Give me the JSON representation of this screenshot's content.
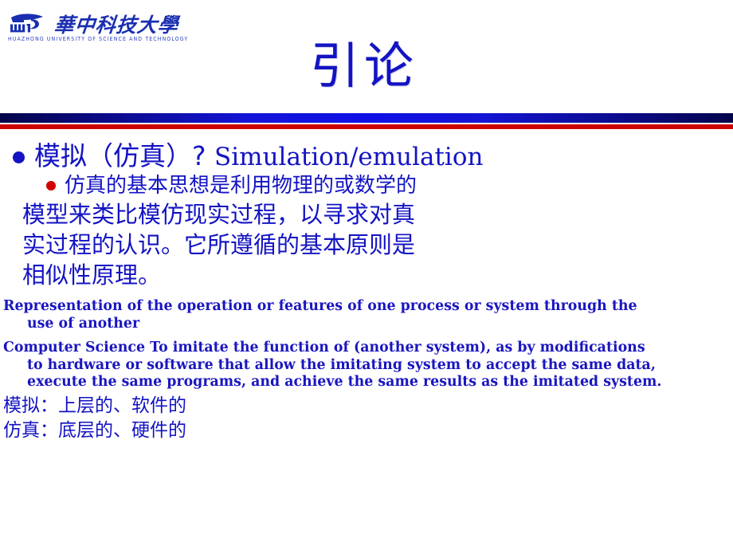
{
  "logo": {
    "emblem_icon": "hust-shield-icon",
    "chinese_name": "華中科技大學",
    "english_name": "HUAZHONG UNIVERSITY OF SCIENCE AND TECHNOLOGY"
  },
  "title": "引论",
  "colors": {
    "title_blue": "#1313c4",
    "bar_blue_dark": "#04044a",
    "bar_blue_bright": "#1010e6",
    "bar_red": "#cc0000",
    "bullet_blue": "#1313c4",
    "bullet_red": "#d40000",
    "text_blue": "#1313c4"
  },
  "content": {
    "bullet_level1": {
      "bullet_icon": "blue-disc-bullet",
      "chinese": "模拟（仿真）? ",
      "latin": "Simulation/emulation"
    },
    "bullet_level2": {
      "bullet_icon": "red-disc-bullet",
      "text": "仿真的基本思想是利用物理的或数学的"
    },
    "chinese_lines": [
      "模型来类比模仿现实过程，以寻求对真",
      "实过程的认识。它所遵循的基本原则是",
      "相似性原理。"
    ],
    "english_paragraphs": [
      {
        "lead": "Representation of the operation or features of one process or system through the",
        "hang": "use of another"
      },
      {
        "lead": "Computer Science To imitate the function of (another system), as by modifications",
        "hang": "to hardware or software that allow the imitating system to accept the same data, execute the same programs, and achieve the same results as the imitated system."
      }
    ],
    "chinese_tail": [
      "模拟：上层的、软件的",
      "仿真：底层的、硬件的"
    ]
  }
}
